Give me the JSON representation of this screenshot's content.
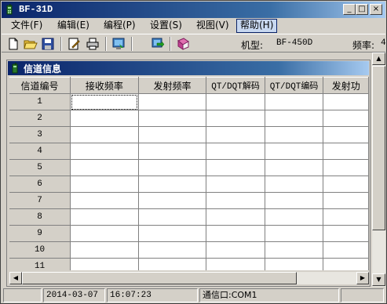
{
  "window": {
    "title": "BF-31D",
    "controls": {
      "minimize": "_",
      "maximize": "□",
      "close": "×"
    }
  },
  "menu": {
    "items": [
      {
        "label": "文件(F)",
        "active": false
      },
      {
        "label": "编辑(E)",
        "active": false
      },
      {
        "label": "编程(P)",
        "active": false
      },
      {
        "label": "设置(S)",
        "active": false
      },
      {
        "label": "视图(V)",
        "active": false
      },
      {
        "label": "帮助(H)",
        "active": true
      }
    ]
  },
  "toolbar": {
    "icons": [
      "new-file-icon",
      "open-folder-icon",
      "save-icon",
      "edit-icon",
      "print-icon",
      "read-from-radio-icon",
      "write-to-radio-icon",
      "help-book-icon"
    ],
    "model_label": "机型:",
    "model_value": "BF-450D",
    "freq_label": "频率:",
    "freq_value": "4"
  },
  "channel_window": {
    "title": "信道信息",
    "columns": [
      "信道编号",
      "接收频率",
      "发射频率",
      "QT/DQT解码",
      "QT/DQT编码",
      "发射功"
    ],
    "rows": [
      "1",
      "2",
      "3",
      "4",
      "5",
      "6",
      "7",
      "8",
      "9",
      "10",
      "11"
    ]
  },
  "statusbar": {
    "date": "2014-03-07",
    "time": "16:07:23",
    "port": "通信口:COM1"
  },
  "colors": {
    "title_gradient_start": "#0a246a",
    "title_gradient_end": "#a6caf0",
    "face": "#d4d0c8"
  }
}
